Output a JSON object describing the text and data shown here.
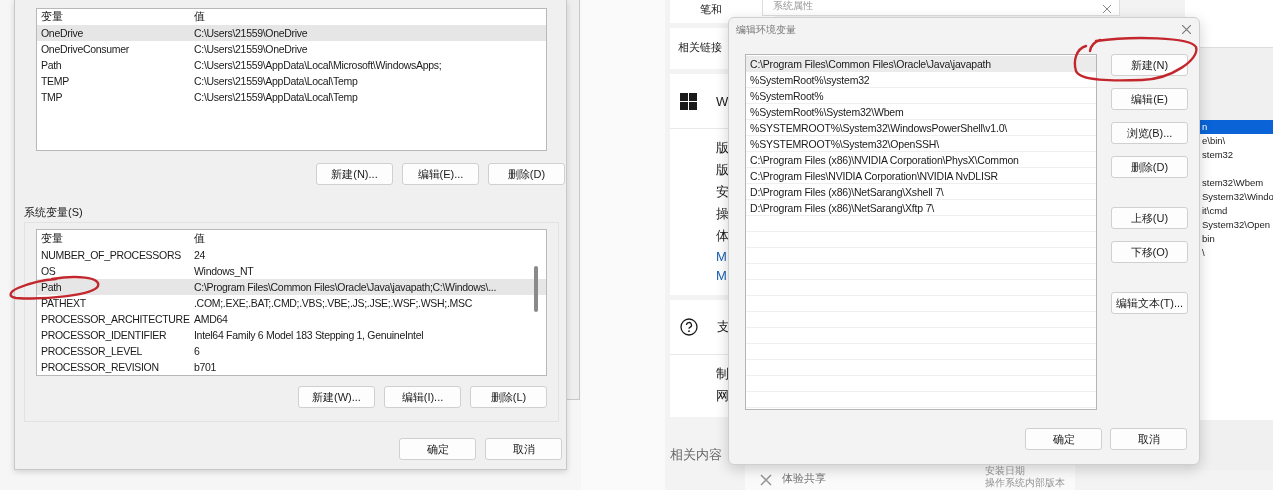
{
  "user_variables": {
    "columns": [
      "变量",
      "值"
    ],
    "rows": [
      {
        "name": "OneDrive",
        "value": "C:\\Users\\21559\\OneDrive",
        "selected": true
      },
      {
        "name": "OneDriveConsumer",
        "value": "C:\\Users\\21559\\OneDrive",
        "selected": false
      },
      {
        "name": "Path",
        "value": "C:\\Users\\21559\\AppData\\Local\\Microsoft\\WindowsApps;",
        "selected": false
      },
      {
        "name": "TEMP",
        "value": "C:\\Users\\21559\\AppData\\Local\\Temp",
        "selected": false
      },
      {
        "name": "TMP",
        "value": "C:\\Users\\21559\\AppData\\Local\\Temp",
        "selected": false
      }
    ],
    "buttons": [
      "新建(N)...",
      "编辑(E)...",
      "删除(D)"
    ]
  },
  "system_variables": {
    "title": "系统变量(S)",
    "columns": [
      "变量",
      "值"
    ],
    "rows": [
      {
        "name": "NUMBER_OF_PROCESSORS",
        "value": "24",
        "selected": false
      },
      {
        "name": "OS",
        "value": "Windows_NT",
        "selected": false
      },
      {
        "name": "Path",
        "value": "C:\\Program Files\\Common Files\\Oracle\\Java\\javapath;C:\\Windows\\...",
        "selected": true
      },
      {
        "name": "PATHEXT",
        "value": ".COM;.EXE;.BAT;.CMD;.VBS;.VBE;.JS;.JSE;.WSF;.WSH;.MSC",
        "selected": false
      },
      {
        "name": "PROCESSOR_ARCHITECTURE",
        "value": "AMD64",
        "selected": false
      },
      {
        "name": "PROCESSOR_IDENTIFIER",
        "value": "Intel64 Family 6 Model 183 Stepping 1, GenuineIntel",
        "selected": false
      },
      {
        "name": "PROCESSOR_LEVEL",
        "value": "6",
        "selected": false
      },
      {
        "name": "PROCESSOR_REVISION",
        "value": "b701",
        "selected": false
      }
    ],
    "buttons": [
      "新建(W)...",
      "编辑(I)...",
      "删除(L)"
    ]
  },
  "dialog_buttons": [
    "确定",
    "取消"
  ],
  "settings_page": {
    "top_item": "笔和",
    "cards": [
      {
        "kind": "header",
        "text": "相关链接"
      },
      {
        "kind": "about",
        "title": "W",
        "lines": [
          {
            "kind": "text",
            "text": "版"
          },
          {
            "kind": "text",
            "text": "版"
          },
          {
            "kind": "text",
            "text": "安"
          },
          {
            "kind": "text",
            "text": "操"
          },
          {
            "kind": "text",
            "text": "体"
          },
          {
            "kind": "link",
            "text": "M"
          },
          {
            "kind": "link",
            "text": "M"
          }
        ]
      },
      {
        "kind": "support",
        "title": "支",
        "lines": [
          {
            "kind": "text",
            "text": "制"
          },
          {
            "kind": "text",
            "text": "网"
          }
        ]
      }
    ],
    "footer_label": "相关内容",
    "share_label": "体验共享",
    "install_labels": [
      "安装日期",
      "操作系统内部版本"
    ]
  },
  "background_window": {
    "title": "系统属性"
  },
  "side_list": {
    "rows": [
      {
        "text": "n",
        "selected": true
      },
      {
        "text": "e\\bin\\",
        "selected": false
      },
      {
        "text": "stem32",
        "selected": false
      },
      {
        "text": "stem32\\Wbem",
        "selected": false
      },
      {
        "text": "System32\\Windo",
        "selected": false
      },
      {
        "text": "it\\cmd",
        "selected": false
      },
      {
        "text": "System32\\Open",
        "selected": false
      },
      {
        "text": "bin",
        "selected": false
      },
      {
        "text": "\\",
        "selected": false
      }
    ]
  },
  "edit_dialog": {
    "title": "编辑环境变量",
    "entries": [
      {
        "text": "C:\\Program Files\\Common Files\\Oracle\\Java\\javapath",
        "selected": true
      },
      {
        "text": "%SystemRoot%\\system32",
        "selected": false
      },
      {
        "text": "%SystemRoot%",
        "selected": false
      },
      {
        "text": "%SystemRoot%\\System32\\Wbem",
        "selected": false
      },
      {
        "text": "%SYSTEMROOT%\\System32\\WindowsPowerShell\\v1.0\\",
        "selected": false
      },
      {
        "text": "%SYSTEMROOT%\\System32\\OpenSSH\\",
        "selected": false
      },
      {
        "text": "C:\\Program Files (x86)\\NVIDIA Corporation\\PhysX\\Common",
        "selected": false
      },
      {
        "text": "C:\\Program Files\\NVIDIA Corporation\\NVIDIA NvDLISR",
        "selected": false
      },
      {
        "text": "D:\\Program Files (x86)\\NetSarang\\Xshell 7\\",
        "selected": false
      },
      {
        "text": "D:\\Program Files (x86)\\NetSarang\\Xftp 7\\",
        "selected": false
      }
    ],
    "button_groups": [
      [
        "新建(N)",
        "编辑(E)",
        "浏览(B)...",
        "删除(D)"
      ],
      [
        "上移(U)",
        "下移(O)"
      ],
      [
        "编辑文本(T)..."
      ]
    ],
    "footer_buttons": [
      "确定",
      "取消"
    ]
  }
}
